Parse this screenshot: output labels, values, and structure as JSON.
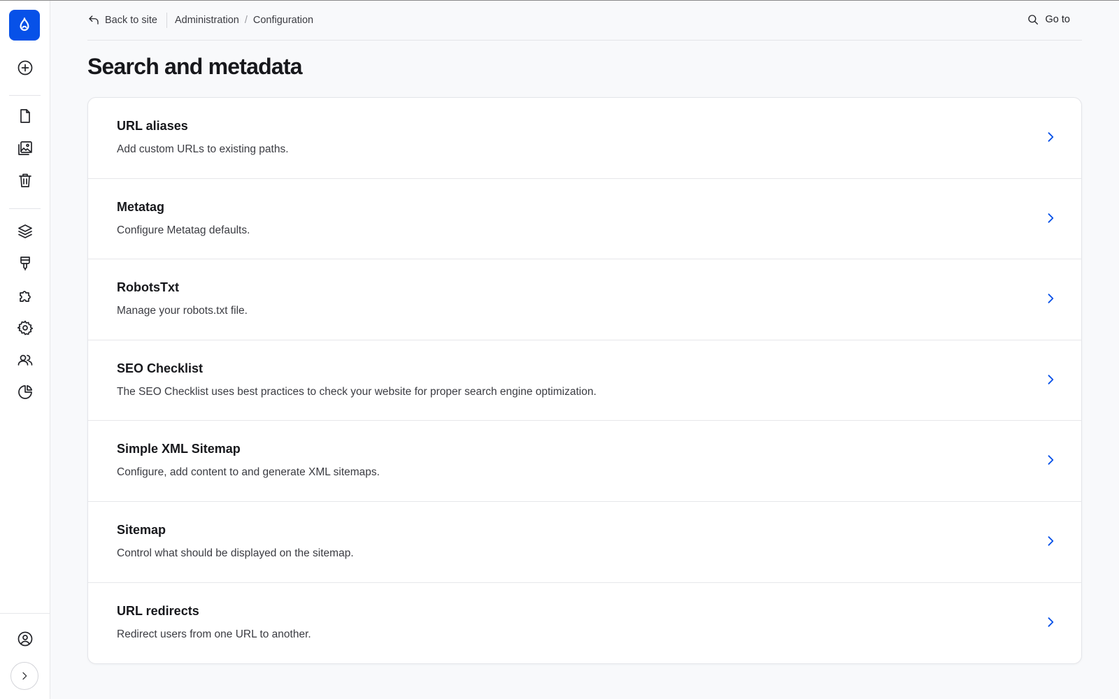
{
  "topbar": {
    "back_label": "Back to site",
    "breadcrumbs": [
      "Administration",
      "Configuration"
    ],
    "breadcrumb_separator": "/",
    "goto_label": "Go to"
  },
  "page": {
    "title": "Search and metadata"
  },
  "items": [
    {
      "title": "URL aliases",
      "description": "Add custom URLs to existing paths."
    },
    {
      "title": "Metatag",
      "description": "Configure Metatag defaults."
    },
    {
      "title": "RobotsTxt",
      "description": "Manage your robots.txt file."
    },
    {
      "title": "SEO Checklist",
      "description": "The SEO Checklist uses best practices to check your website for proper search engine optimization."
    },
    {
      "title": "Simple XML Sitemap",
      "description": "Configure, add content to and generate XML sitemaps."
    },
    {
      "title": "Sitemap",
      "description": "Control what should be displayed on the sitemap."
    },
    {
      "title": "URL redirects",
      "description": "Redirect users from one URL to another."
    }
  ],
  "sidebar": {
    "icons": [
      "drupal-logo-icon",
      "plus-circle-icon",
      "file-icon",
      "image-gallery-icon",
      "trash-icon",
      "layers-icon",
      "brush-icon",
      "puzzle-icon",
      "gear-icon",
      "users-icon",
      "pie-chart-icon",
      "user-circle-icon",
      "chevron-right-icon"
    ]
  },
  "colors": {
    "accent": "#0751e8",
    "background": "#f8f9fb",
    "text": "#232429"
  }
}
